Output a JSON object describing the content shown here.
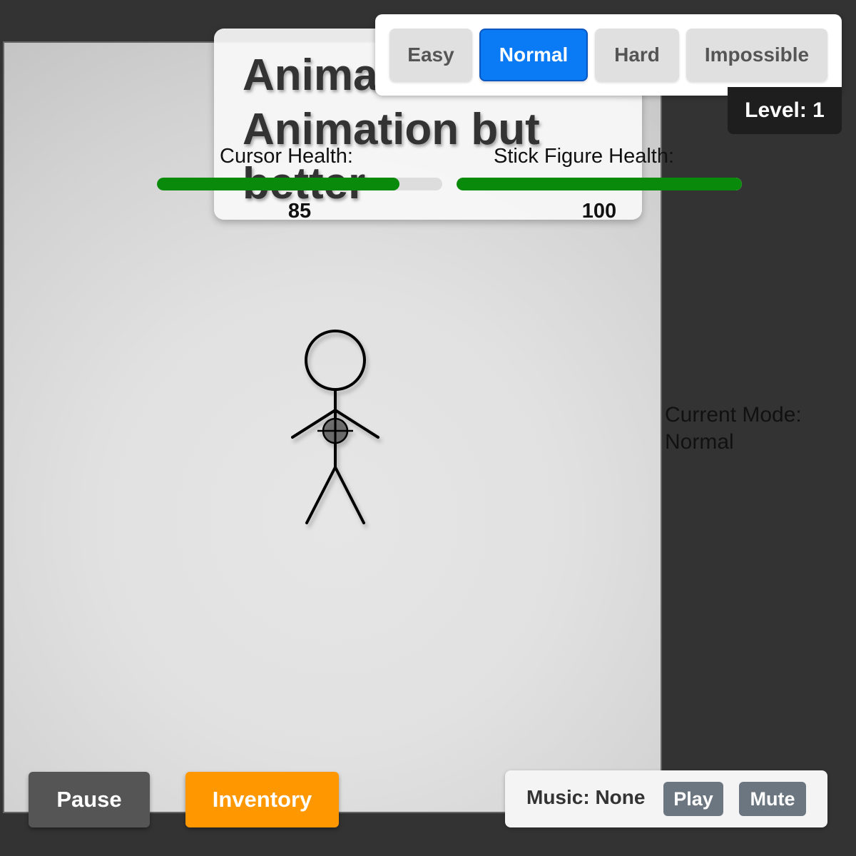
{
  "title": "Animation vs Animation but better",
  "difficulty": {
    "options": [
      "Easy",
      "Normal",
      "Hard",
      "Impossible"
    ],
    "selected": "Normal"
  },
  "level": {
    "text": "Level: 1"
  },
  "health": {
    "cursor": {
      "label": "Cursor Health:",
      "value": 85,
      "value_text": "85",
      "fraction": 0.85
    },
    "stick_figure": {
      "label": "Stick Figure Health:",
      "value": 100,
      "value_text": "100",
      "fraction": 1.0
    },
    "bar_color": "#0a8a0a"
  },
  "mode": {
    "label": "Current Mode:",
    "value": "Normal"
  },
  "buttons": {
    "pause": "Pause",
    "inventory": "Inventory"
  },
  "music": {
    "label": "Music: None",
    "play": "Play",
    "mute": "Mute"
  },
  "colors": {
    "background": "#333333",
    "selected_difficulty": "#0a7af5",
    "pause_button": "#555555",
    "inventory_button": "#ff9800",
    "music_buttons": "#6c7680"
  },
  "icons": {
    "cursor": "crosshair-cursor-icon",
    "enemy": "stick-figure"
  }
}
